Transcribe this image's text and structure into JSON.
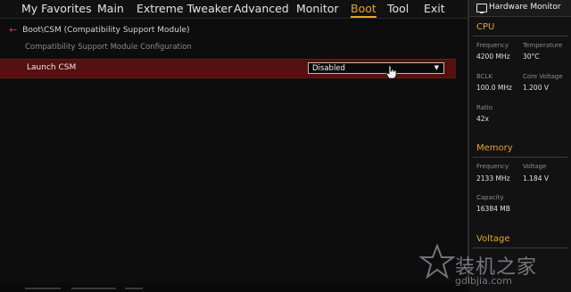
{
  "nav": {
    "tabs": [
      {
        "label": "My Favorites"
      },
      {
        "label": "Main"
      },
      {
        "label": "Extreme Tweaker"
      },
      {
        "label": "Advanced"
      },
      {
        "label": "Monitor"
      },
      {
        "label": "Boot",
        "active": true
      },
      {
        "label": "Tool"
      },
      {
        "label": "Exit"
      }
    ]
  },
  "breadcrumb": "Boot\\CSM (Compatibility Support Module)",
  "subtitle": "Compatibility Support Module Configuration",
  "setting": {
    "label": "Launch CSM",
    "value": "Disabled"
  },
  "hw_monitor": {
    "title": "Hardware Monitor",
    "cpu": {
      "heading": "CPU",
      "frequency_label": "Frequency",
      "frequency": "4200 MHz",
      "temperature_label": "Temperature",
      "temperature": "30°C",
      "bclk_label": "BCLK",
      "bclk": "100.0 MHz",
      "core_voltage_label": "Core Voltage",
      "core_voltage": "1.200 V",
      "ratio_label": "Ratio",
      "ratio": "42x"
    },
    "memory": {
      "heading": "Memory",
      "frequency_label": "Frequency",
      "frequency": "2133 MHz",
      "voltage_label": "Voltage",
      "voltage": "1.184 V",
      "capacity_label": "Capacity",
      "capacity": "16384 MB"
    },
    "voltage": {
      "heading": "Voltage"
    }
  },
  "watermark": {
    "text": "装机之家",
    "url": "gdlbjia.com"
  },
  "colors": {
    "accent": "#e8a42a",
    "selection_row": "#55100f",
    "back_arrow": "#d23b2e"
  }
}
